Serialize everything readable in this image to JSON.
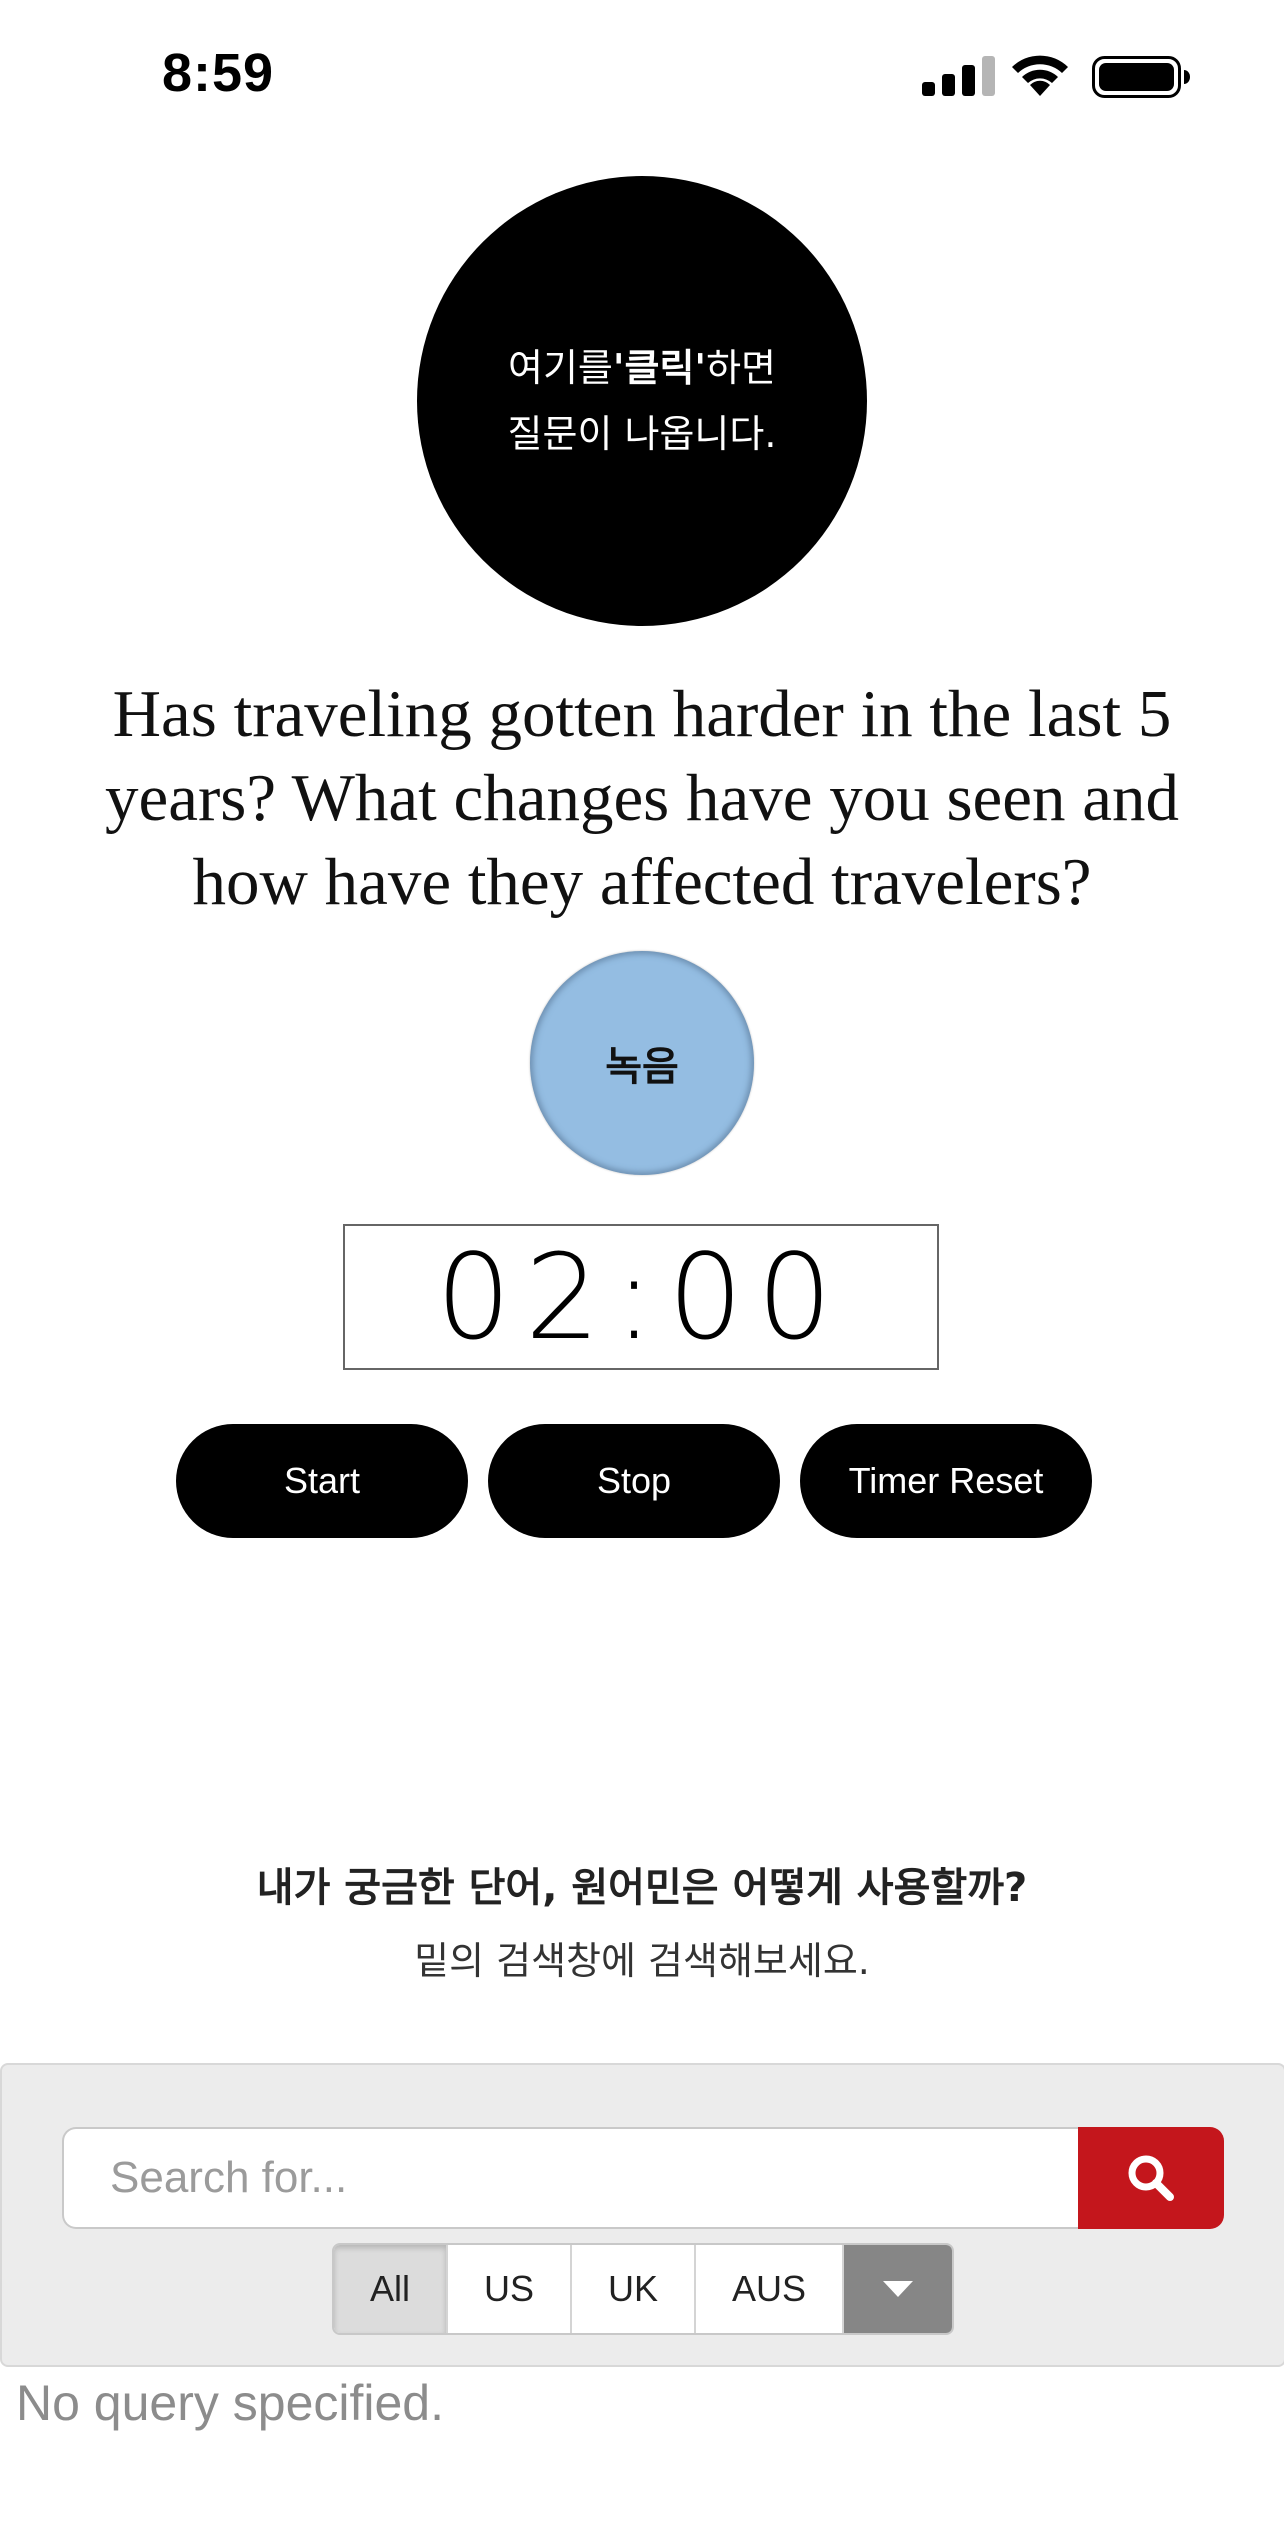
{
  "status_bar": {
    "time": "8:59",
    "signal_bars_active": 3,
    "signal_bars_total": 4,
    "battery_level": 1.0
  },
  "question_circle": {
    "line1_prefix": "여기를",
    "line1_bold": "'클릭'",
    "line1_suffix": "하면",
    "line2": "질문이 나옵니다."
  },
  "question": {
    "text": "Has traveling gotten harder in the last 5 years? What changes have you seen and how have they affected travelers?"
  },
  "record": {
    "label": "녹음",
    "color": "#94bde2"
  },
  "timer": {
    "display": "02:00"
  },
  "controls": {
    "start_label": "Start",
    "stop_label": "Stop",
    "reset_label": "Timer Reset"
  },
  "promo": {
    "title": "내가 궁금한 단어, 원어민은 어떻게 사용할까?",
    "subtitle": "밑의 검색창에 검색해보세요."
  },
  "search": {
    "placeholder": "Search for...",
    "value": "",
    "button_color": "#c4161c",
    "filters": [
      {
        "label": "All",
        "active": true
      },
      {
        "label": "US",
        "active": false
      },
      {
        "label": "UK",
        "active": false
      },
      {
        "label": "AUS",
        "active": false
      }
    ],
    "result_message": "No query specified."
  }
}
